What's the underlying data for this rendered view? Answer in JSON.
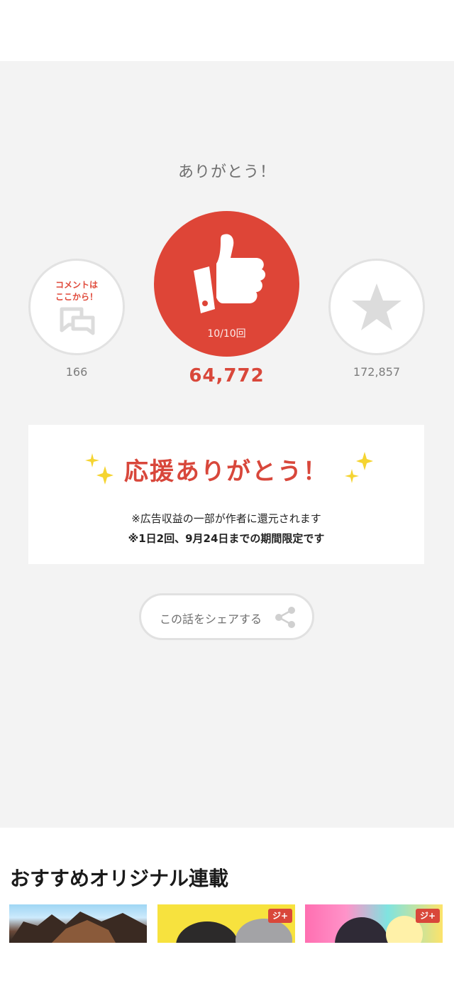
{
  "thanks_title": "ありがとう！",
  "comment": {
    "cta_line1": "コメントは",
    "cta_line2": "ここから！",
    "count": "166",
    "icon": "comment-icon"
  },
  "like": {
    "progress": "10/10回",
    "count": "64,772",
    "icon": "thumbs-up-icon",
    "color": "#de4537"
  },
  "favorite": {
    "count": "172,857",
    "icon": "star-icon"
  },
  "support": {
    "title": "応援ありがとう！",
    "note1": "※広告収益の一部が作者に還元されます",
    "note2": "※1日2回、9月24日までの期間限定です"
  },
  "share": {
    "label": "この話をシェアする",
    "icon": "share-icon"
  },
  "recommend": {
    "title": "おすすめオリジナル連載",
    "badge": "ジ+"
  }
}
